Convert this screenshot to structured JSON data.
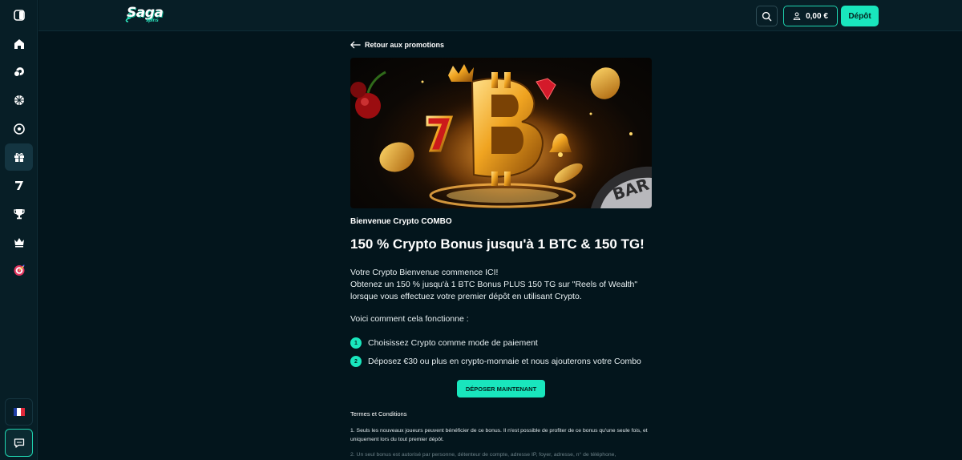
{
  "header": {
    "logo_main": "Saga",
    "logo_sub": "spins",
    "balance": "0,00 €",
    "deposit_label": "Dépôt"
  },
  "sidebar": {
    "items": [
      {
        "icon": "panel-toggle-icon"
      },
      {
        "icon": "home-icon"
      },
      {
        "icon": "casino-chips-icon"
      },
      {
        "icon": "sports-ball-icon"
      },
      {
        "icon": "soccer-ball-icon"
      },
      {
        "icon": "gift-icon",
        "active": true
      },
      {
        "icon": "slot-seven-icon"
      },
      {
        "icon": "trophy-icon"
      },
      {
        "icon": "crown-icon"
      },
      {
        "icon": "target-icon"
      }
    ],
    "language_flag": "fr-flag-icon",
    "chat_icon": "chat-icon"
  },
  "main": {
    "back_label": "Retour aux promotions",
    "banner_alt": "crypto-bitcoin-banner",
    "promo_label": "Bienvenue Crypto COMBO",
    "promo_title": "150 % Crypto Bonus jusqu'à 1 BTC & 150 TG!",
    "description_lines": [
      "Votre Crypto Bienvenue commence ICI!",
      "Obtenez un 150 % jusqu'à 1 BTC Bonus PLUS 150 TG sur \"Reels of Wealth\"",
      "lorsque vous effectuez votre premier dépôt en utilisant Crypto."
    ],
    "howto_label": "Voici comment cela fonctionne :",
    "steps": [
      {
        "num": "1",
        "text": "Choisissez Crypto comme mode de paiement"
      },
      {
        "num": "2",
        "text": "Déposez €30 ou plus en crypto-monnaie et nous ajouterons votre Combo"
      }
    ],
    "cta_label": "DÉPOSER MAINTENANT",
    "terms_title": "Termes et Conditions",
    "terms_items": [
      "1. Seuls les nouveaux joueurs peuvent bénéficier de ce bonus. Il n'est possible de profiter de ce bonus qu'une seule fois, et uniquement lors du tout premier dépôt.",
      "2. Un seul bonus est autorisé par personne, détenteur de compte, adresse IP, foyer, adresse, n° de téléphone,"
    ]
  },
  "colors": {
    "accent": "#19e6bd",
    "background": "#03151c",
    "sidebar": "#071e26"
  }
}
